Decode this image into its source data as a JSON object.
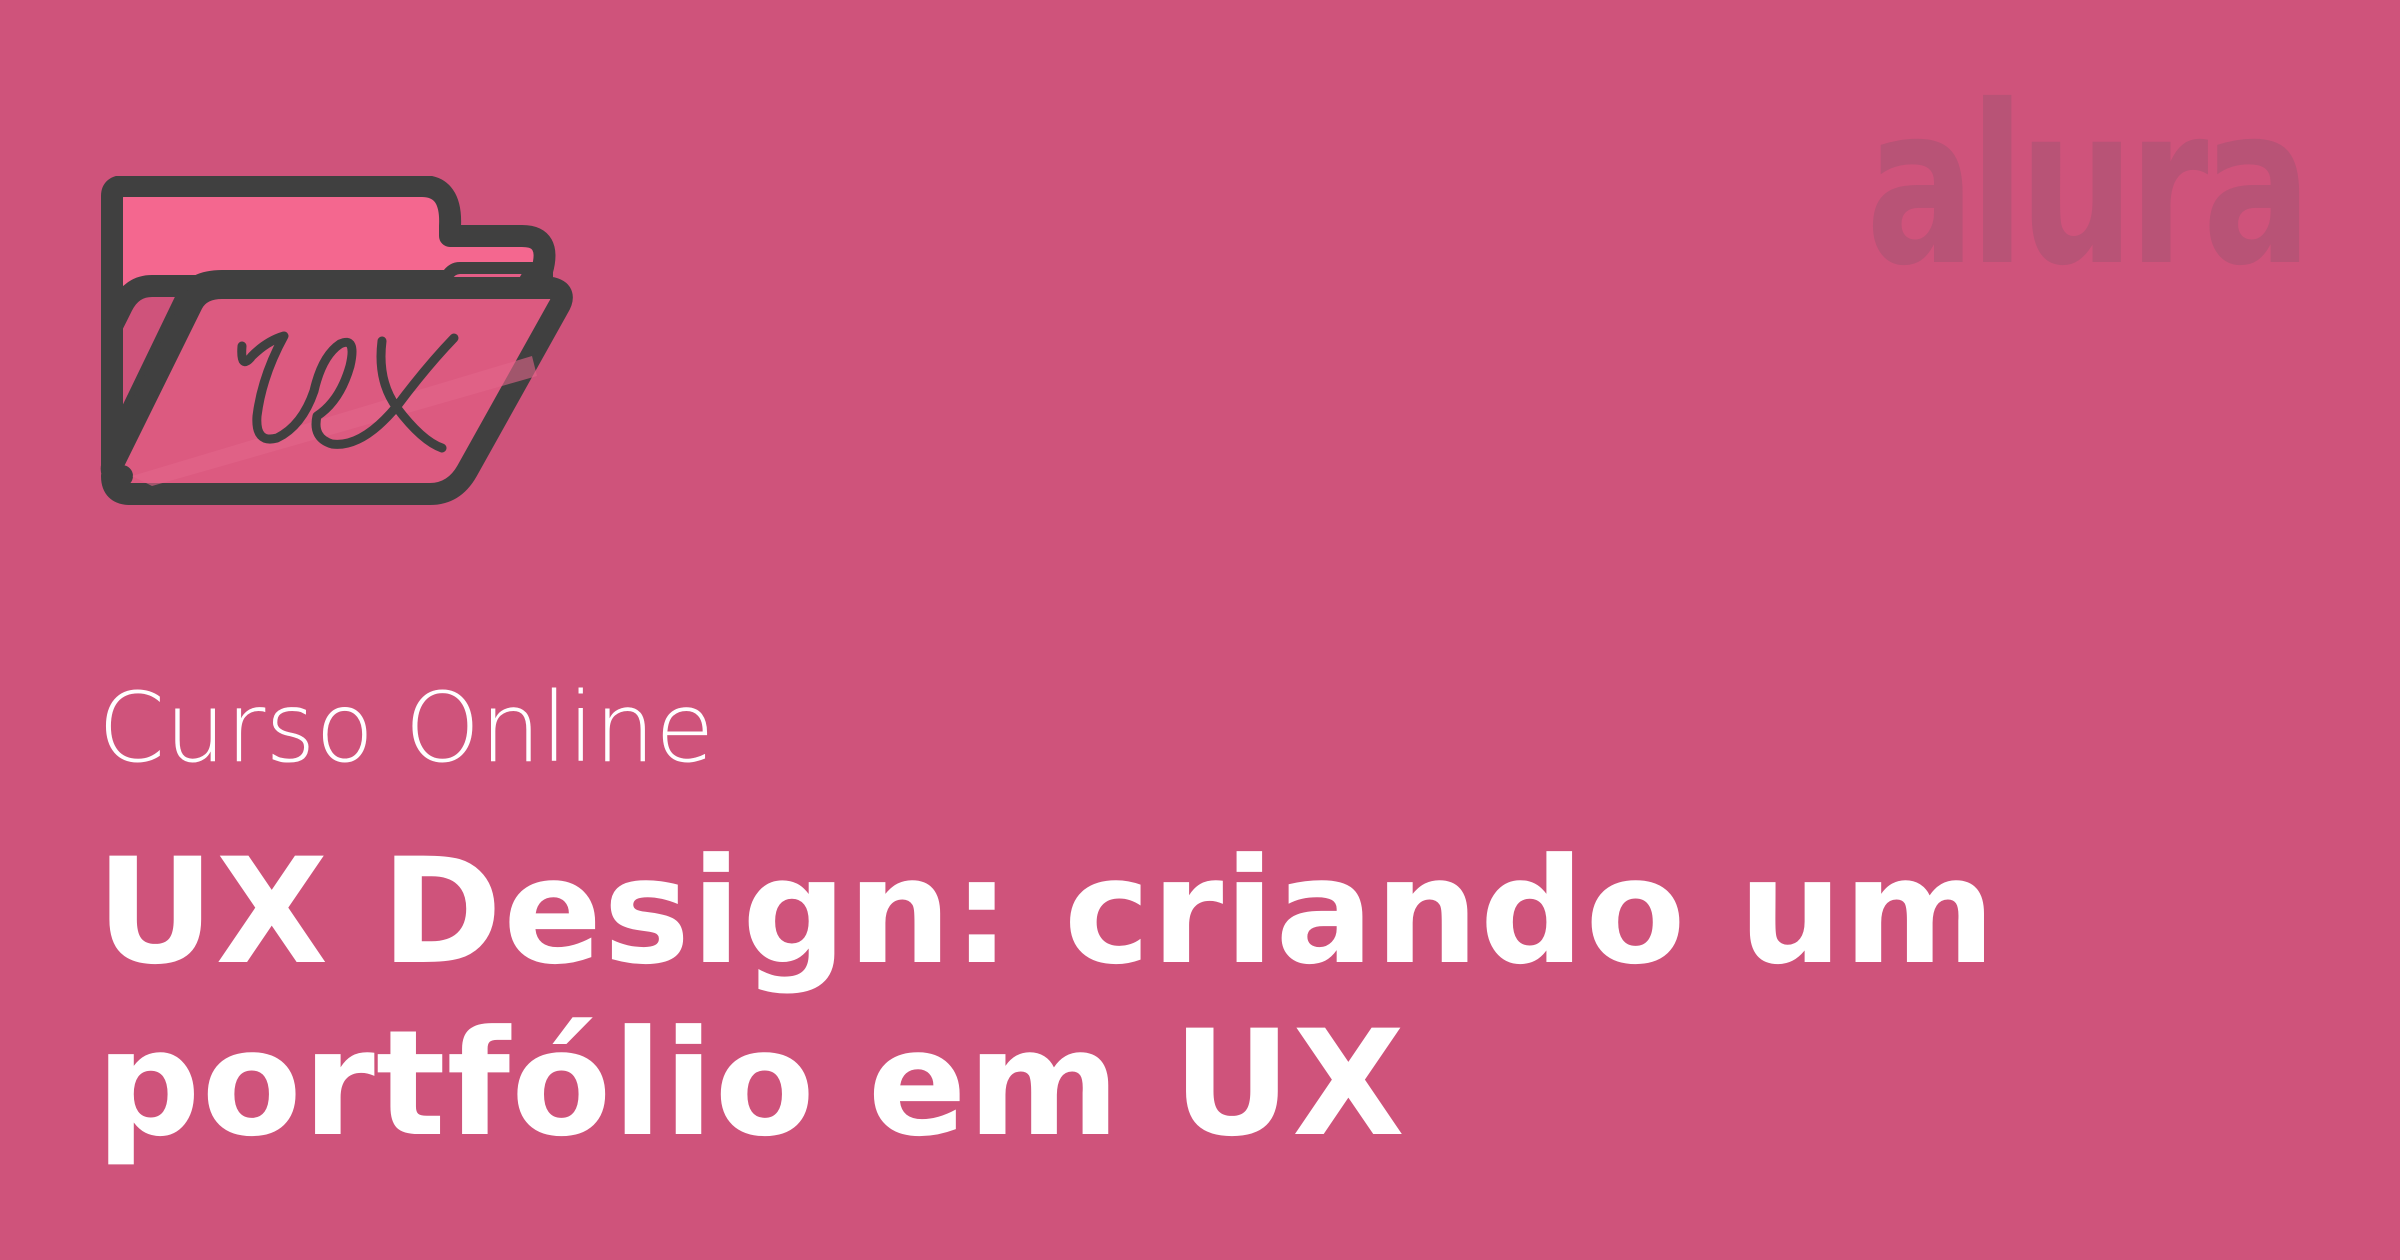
{
  "banner": {
    "subtitle": "Curso Online",
    "title": "UX Design: criando um portfólio em UX",
    "logo_text": "alura",
    "background_color": "#cf537b"
  },
  "icon": {
    "name": "folder-ux-icon",
    "colors": {
      "outline": "#404040",
      "back_fill": "#f4678f",
      "front_fill": "#dc5a80"
    }
  }
}
